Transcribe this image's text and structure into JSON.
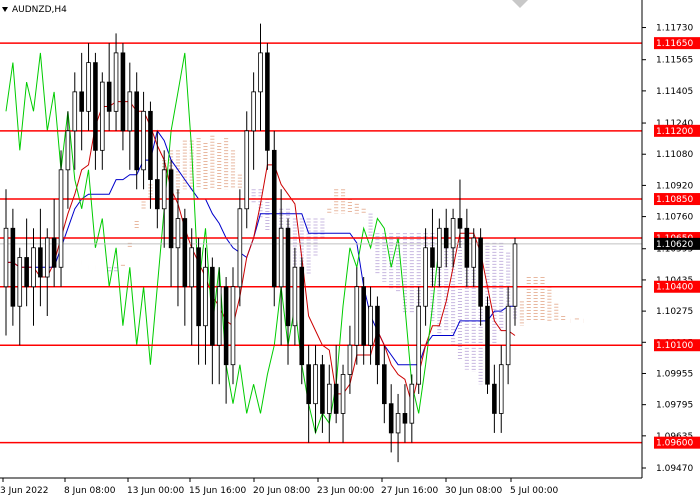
{
  "chart_data": {
    "type": "candlestick",
    "symbol": "AUDNZD,H4",
    "ylim": [
      1.0947,
      1.1182
    ],
    "y_ticks": [
      "1.11730",
      "1.11565",
      "1.11405",
      "1.11240",
      "1.11080",
      "1.10920",
      "1.10760",
      "1.10595",
      "1.10435",
      "1.10275",
      "1.10115",
      "1.09955",
      "1.09795",
      "1.09635",
      "1.09470"
    ],
    "x_ticks": [
      "3 Jun 2022",
      "8 Jun 08:00",
      "13 Jun 00:00",
      "15 Jun 16:00",
      "20 Jun 08:00",
      "23 Jun 00:00",
      "27 Jun 16:00",
      "30 Jun 08:00",
      "5 Jul 00:00"
    ],
    "current_price": "1.10620",
    "levels": [
      "1.11650",
      "1.11200",
      "1.10850",
      "1.10650",
      "1.10400",
      "1.10100",
      "1.09600"
    ],
    "ohlc": [
      [
        1.104,
        1.109,
        1.1015,
        1.107
      ],
      [
        1.107,
        1.108,
        1.102,
        1.103
      ],
      [
        1.103,
        1.106,
        1.101,
        1.1055
      ],
      [
        1.1055,
        1.1075,
        1.103,
        1.104
      ],
      [
        1.104,
        1.107,
        1.102,
        1.106
      ],
      [
        1.106,
        1.108,
        1.103,
        1.1045
      ],
      [
        1.1045,
        1.107,
        1.1025,
        1.1065
      ],
      [
        1.1065,
        1.1085,
        1.104,
        1.105
      ],
      [
        1.105,
        1.111,
        1.104,
        1.11
      ],
      [
        1.11,
        1.113,
        1.108,
        1.112
      ],
      [
        1.112,
        1.115,
        1.11,
        1.114
      ],
      [
        1.114,
        1.116,
        1.111,
        1.113
      ],
      [
        1.113,
        1.1165,
        1.112,
        1.1155
      ],
      [
        1.1155,
        1.116,
        1.11,
        1.111
      ],
      [
        1.111,
        1.115,
        1.11,
        1.1145
      ],
      [
        1.1145,
        1.1165,
        1.112,
        1.113
      ],
      [
        1.113,
        1.117,
        1.112,
        1.116
      ],
      [
        1.116,
        1.1165,
        1.111,
        1.112
      ],
      [
        1.112,
        1.1155,
        1.11,
        1.114
      ],
      [
        1.114,
        1.115,
        1.109,
        1.11
      ],
      [
        1.11,
        1.114,
        1.109,
        1.113
      ],
      [
        1.113,
        1.1135,
        1.108,
        1.1095
      ],
      [
        1.1095,
        1.112,
        1.107,
        1.108
      ],
      [
        1.108,
        1.111,
        1.106,
        1.11
      ],
      [
        1.11,
        1.1105,
        1.104,
        1.106
      ],
      [
        1.106,
        1.109,
        1.103,
        1.1075
      ],
      [
        1.1075,
        1.108,
        1.102,
        1.104
      ],
      [
        1.104,
        1.107,
        1.101,
        1.106
      ],
      [
        1.106,
        1.1065,
        1.1,
        1.102
      ],
      [
        1.102,
        1.106,
        1.1,
        1.105
      ],
      [
        1.105,
        1.1055,
        1.099,
        1.101
      ],
      [
        1.101,
        1.105,
        1.099,
        1.104
      ],
      [
        1.104,
        1.1045,
        1.098,
        1.1
      ],
      [
        1.1,
        1.105,
        1.099,
        1.104
      ],
      [
        1.104,
        1.109,
        1.103,
        1.108
      ],
      [
        1.108,
        1.113,
        1.107,
        1.112
      ],
      [
        1.112,
        1.115,
        1.11,
        1.114
      ],
      [
        1.114,
        1.1175,
        1.112,
        1.116
      ],
      [
        1.116,
        1.1165,
        1.11,
        1.111
      ],
      [
        1.111,
        1.112,
        1.103,
        1.104
      ],
      [
        1.104,
        1.109,
        1.101,
        1.107
      ],
      [
        1.107,
        1.1075,
        1.1,
        1.102
      ],
      [
        1.102,
        1.106,
        1.101,
        1.105
      ],
      [
        1.105,
        1.1055,
        1.099,
        1.1
      ],
      [
        1.1,
        1.101,
        1.096,
        1.098
      ],
      [
        1.098,
        1.101,
        1.0965,
        1.1
      ],
      [
        1.1,
        1.1005,
        1.0965,
        1.0975
      ],
      [
        1.0975,
        1.1,
        1.096,
        1.099
      ],
      [
        1.099,
        1.101,
        1.097,
        1.0975
      ],
      [
        1.0975,
        1.1,
        1.096,
        1.0995
      ],
      [
        1.0995,
        1.102,
        1.0985,
        1.101
      ],
      [
        1.101,
        1.105,
        1.1,
        1.104
      ],
      [
        1.104,
        1.1045,
        1.1,
        1.101
      ],
      [
        1.101,
        1.104,
        1.1,
        1.103
      ],
      [
        1.103,
        1.1035,
        1.099,
        1.1
      ],
      [
        1.1,
        1.101,
        1.097,
        1.098
      ],
      [
        1.098,
        1.099,
        1.0955,
        1.0965
      ],
      [
        1.0965,
        1.0985,
        1.095,
        1.0975
      ],
      [
        1.0975,
        1.099,
        1.096,
        1.097
      ],
      [
        1.097,
        1.0995,
        1.096,
        1.099
      ],
      [
        1.099,
        1.104,
        1.0985,
        1.103
      ],
      [
        1.103,
        1.107,
        1.102,
        1.106
      ],
      [
        1.106,
        1.108,
        1.104,
        1.105
      ],
      [
        1.105,
        1.1075,
        1.104,
        1.107
      ],
      [
        1.107,
        1.108,
        1.105,
        1.106
      ],
      [
        1.106,
        1.108,
        1.105,
        1.1075
      ],
      [
        1.1075,
        1.1095,
        1.106,
        1.107
      ],
      [
        1.107,
        1.108,
        1.104,
        1.105
      ],
      [
        1.105,
        1.107,
        1.104,
        1.1065
      ],
      [
        1.1065,
        1.107,
        1.102,
        1.103
      ],
      [
        1.103,
        1.1035,
        1.0985,
        1.099
      ],
      [
        1.099,
        1.1,
        1.0965,
        1.0975
      ],
      [
        1.0975,
        1.101,
        1.0965,
        1.1
      ],
      [
        1.1,
        1.104,
        1.099,
        1.103
      ],
      [
        1.103,
        1.1065,
        1.102,
        1.1062
      ]
    ]
  }
}
